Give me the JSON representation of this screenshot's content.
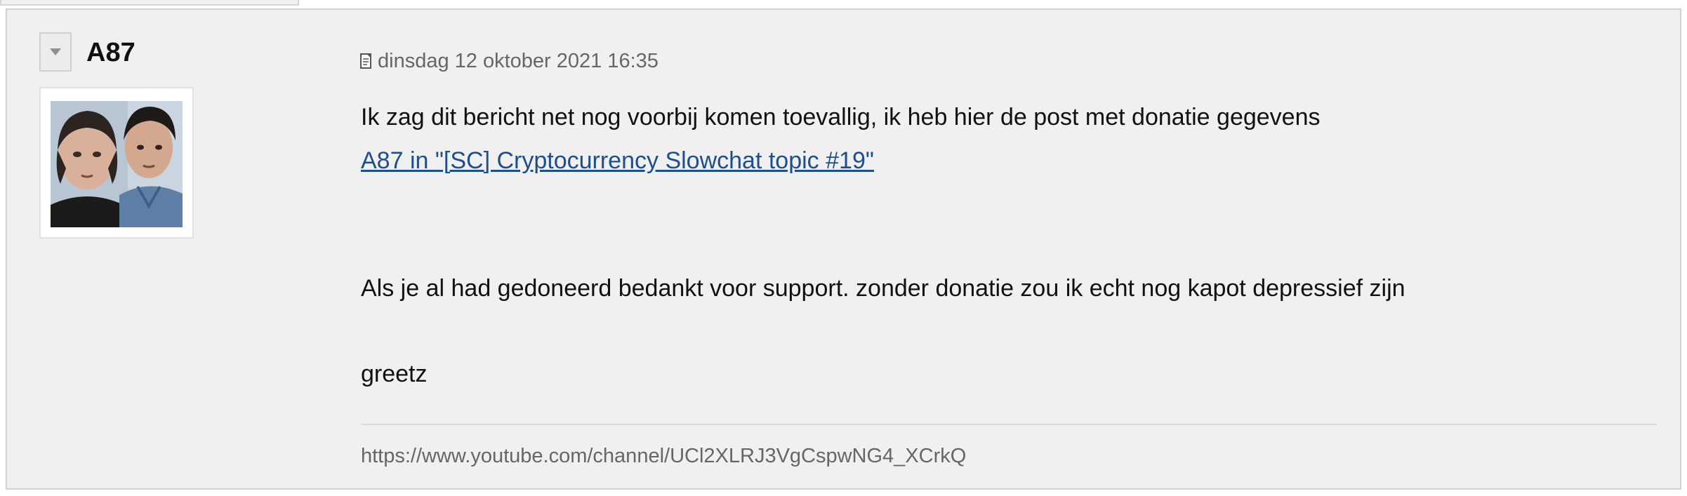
{
  "post": {
    "username": "A87",
    "date": "dinsdag 12 oktober 2021 16:35",
    "lines": [
      "Ik zag dit bericht net nog voorbij komen toevallig, ik heb hier de post met donatie gegevens",
      "Als je al had gedoneerd bedankt voor support. zonder donatie zou ik echt nog kapot depressief zijn",
      "greetz"
    ],
    "quote_link": "A87 in \"[SC] Cryptocurrency Slowchat topic #19\"",
    "signature": "https://www.youtube.com/channel/UCl2XLRJ3VgCspwNG4_XCrkQ"
  },
  "icons": {
    "toggle": "triangle-down-icon",
    "post_date": "document-icon"
  },
  "colors": {
    "post_background": "#f0f0f0",
    "link": "#1f4f8a",
    "meta_text": "#666666"
  }
}
